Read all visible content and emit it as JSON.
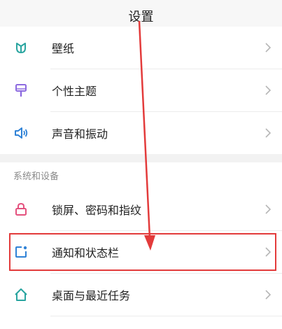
{
  "header": {
    "title": "设置"
  },
  "items_top": [
    {
      "label": "壁纸",
      "icon": "tulip-wallpaper-icon"
    },
    {
      "label": "个性主题",
      "icon": "brush-icon"
    },
    {
      "label": "声音和振动",
      "icon": "speaker-icon"
    }
  ],
  "section": {
    "title": "系统和设备"
  },
  "items_bottom": [
    {
      "label": "锁屏、密码和指纹",
      "icon": "lock-icon"
    },
    {
      "label": "通知和状态栏",
      "icon": "notification-icon"
    },
    {
      "label": "桌面与最近任务",
      "icon": "home-icon"
    }
  ],
  "colors": {
    "accent_teal": "#2aa5a0",
    "purple": "#8d6be0",
    "blue": "#2f82d6",
    "pink": "#e4517e",
    "annotation_red": "#e33b3b"
  }
}
